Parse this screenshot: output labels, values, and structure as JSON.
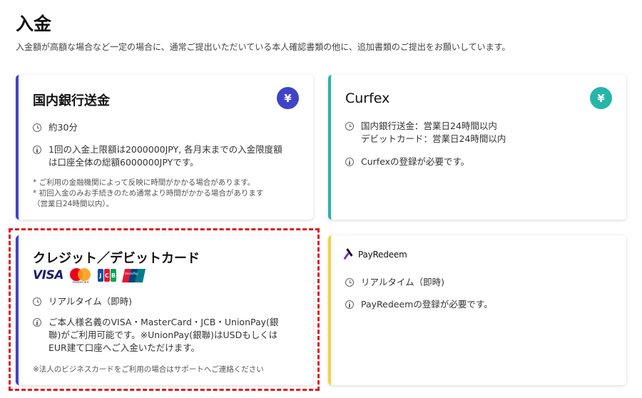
{
  "page": {
    "title": "入金",
    "description": "入金額が高額な場合など一定の場合に、通常ご提出いただいている本人確認書類の他に、追加書類のご提出をお願いしています。"
  },
  "bank_card": {
    "title": "国内銀行送金",
    "badge": "¥",
    "time": "約30分",
    "limit_line1": "1回の入金上限額は2000000JPY, 各月末までの入金限度額",
    "limit_line2": "は口座全体の総額6000000JPYです。",
    "note1": "* ご利用の金融機関によって反映に時間がかかる場合があります。",
    "note2": "* 初回入金のみお手続きのため通常より時間がかかる場合があります",
    "note3": "（営業日24時間以内）。"
  },
  "curfex_card": {
    "title": "Curfex",
    "badge": "¥",
    "time_line1": "国内銀行送金：営業日24時間以内",
    "time_line2": "デビットカード：営業日24時間以内",
    "requirement": "Curfexの登録が必要です。"
  },
  "credit_card": {
    "title": "クレジット／デビットカード",
    "logo_visa": "VISA",
    "logo_mc": "mastercard",
    "logo_jcb": [
      "J",
      "C",
      "B"
    ],
    "logo_up": "UnionPay",
    "time": "リアルタイム（即時)",
    "info_line1": "ご本人様名義のVISA・MasterCard・JCB・UnionPay(銀",
    "info_line2": "聯)がご利用可能です。※UnionPay(銀聯)はUSDもしくは",
    "info_line3": "EUR建て口座へご入金いただけます。",
    "note": "※法人のビジネスカードをご利用の場合はサポートへご連絡ください"
  },
  "payredeem_card": {
    "logo_text": "PayRedeem",
    "time": "リアルタイム（即時)",
    "requirement": "PayRedeemの登録が必要です。"
  },
  "colors": {
    "accent_blue": "#3e43c8",
    "accent_teal": "#26b5a8",
    "accent_yellow": "#f3d43c",
    "highlight_red": "#e0161e"
  }
}
